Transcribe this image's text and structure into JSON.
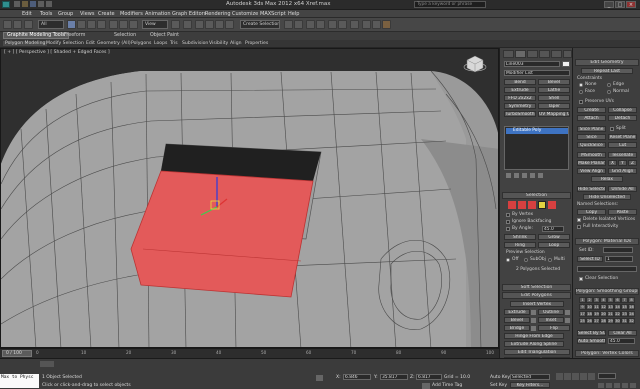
{
  "window": {
    "title": "Autodesk 3ds Max 2012 x64        Xref.max",
    "search_placeholder": "Type a keyword or phrase",
    "minimize": "_",
    "maximize": "□",
    "close": "×"
  },
  "menu": [
    "Edit",
    "Tools",
    "Group",
    "Views",
    "Create",
    "Modifiers",
    "Animation",
    "Graph Editors",
    "Rendering",
    "Customize",
    "MAXScript",
    "Help"
  ],
  "toolbar": {
    "selection_filter": "All",
    "view_dropdown": "View",
    "named_sets": "Create Selection Se"
  },
  "ribbon": {
    "tabs": [
      "Graphite Modeling Tools",
      "Freeform",
      "Selection",
      "Object Paint"
    ],
    "active_tab": "Graphite Modeling Tools",
    "row": [
      "Polygon Modeling",
      "Modify Selection",
      "Edit",
      "Geometry (All)",
      "Polygons",
      "Loops",
      "Tris",
      "Subdivision",
      "Visibility",
      "Align",
      "Properties"
    ]
  },
  "viewport": {
    "label": "[ + ] [ Perspective ] [ Shaded + Edged Faces ]"
  },
  "command_panel": {
    "object_name": "Line003",
    "modifier_list": "Modifier List",
    "quick_buttons": [
      [
        "Bend",
        "Bevel"
      ],
      [
        "Extrude",
        "Lathe"
      ],
      [
        "FFD 2x2x2",
        "Shell"
      ],
      [
        "Symmetry",
        "Taper"
      ],
      [
        "TurboSmooth",
        "UV Mapping Cle"
      ]
    ],
    "stack_item": "Editable Poly",
    "selection_title": "Selection",
    "by_vertex": "By Vertex",
    "ignore_backfacing": "Ignore Backfacing",
    "by_angle": "By Angle:",
    "angle_value": "45.0",
    "shrink": "Shrink",
    "grow": "Grow",
    "ring": "Ring",
    "loop": "Loop",
    "preview_selection": "Preview Selection",
    "preview_off": "Off",
    "preview_subobj": "SubObj",
    "preview_multi": "Multi",
    "selected_status": "2 Polygons Selected",
    "soft_selection": "Soft Selection",
    "edit_polygons": "Edit Polygons",
    "insert_vertex": "Insert Vertex",
    "edit_buttons": [
      [
        "Extrude",
        "Outline"
      ],
      [
        "Bevel",
        "Inset"
      ],
      [
        "Bridge",
        "Flip"
      ]
    ],
    "hinge": "Hinge From Edge",
    "extrude_spline": "Extrude Along Spline",
    "edit_triangulation": "Edit Triangulation",
    "retriangulate": "Retriangulate",
    "turn": "Turn"
  },
  "right_panel": {
    "edit_geometry": "Edit Geometry",
    "repeat_last": "Repeat Last",
    "constraints": "Constraints",
    "c_none": "None",
    "c_edge": "Edge",
    "c_face": "Face",
    "c_normal": "Normal",
    "preserve_uvs": "Preserve UVs",
    "create": "Create",
    "collapse": "Collapse",
    "attach": "Attach",
    "detach": "Detach",
    "slice_plane": "Slice Plane",
    "split": "Split",
    "slice": "Slice",
    "reset_plane": "Reset Plane",
    "quickslice": "QuickSlice",
    "cut": "Cut",
    "msmooth": "MSmooth",
    "tessellate": "Tessellate",
    "make_planar": "Make Planar",
    "x": "X",
    "y": "Y",
    "z": "Z",
    "view_align": "View Align",
    "grid_align": "Grid Align",
    "relax": "Relax",
    "hide_selected": "Hide Selected",
    "unhide_all": "Unhide All",
    "hide_unselected": "Hide Unselected",
    "named_selections": "Named Selections:",
    "copy": "Copy",
    "paste": "Paste",
    "delete_isolated": "Delete Isolated Vertices",
    "full_interactivity": "Full Interactivity",
    "material_ids": "Polygon: Material IDs",
    "set_id": "Set ID:",
    "select_id": "Select ID",
    "id_value": "1",
    "clear_selection": "Clear Selection",
    "smoothing_groups": "Polygon: Smoothing Groups",
    "groups": [
      "1",
      "2",
      "3",
      "4",
      "5",
      "6",
      "7",
      "8",
      "9",
      "10",
      "11",
      "12",
      "13",
      "14",
      "15",
      "16",
      "17",
      "18",
      "19",
      "20",
      "21",
      "22",
      "23",
      "24",
      "25",
      "26",
      "27",
      "28",
      "29",
      "30",
      "31",
      "32"
    ],
    "select_by_sg": "Select By SG",
    "clear_all": "Clear All",
    "auto_smooth": "Auto Smooth",
    "auto_value": "45.0",
    "vertex_colors": "Polygon: Vertex Colors",
    "color": "Color:"
  },
  "timeline": {
    "frame": "0 / 100",
    "ticks": [
      "0",
      "10",
      "20",
      "30",
      "40",
      "50",
      "60",
      "70",
      "80",
      "90",
      "100"
    ]
  },
  "status": {
    "maxscript_line1": "Max to Physc",
    "maxscript_line2": "",
    "objects_selected": "1 Object Selected",
    "prompt": "Click or click-and-drag to select objects",
    "x_label": "X:",
    "x_value": "6.846",
    "y_label": "Y:",
    "y_value": "35.817",
    "z_label": "Z:",
    "z_value": "6.817",
    "grid": "Grid = 10.0",
    "auto_key": "Auto Key",
    "selected": "Selected",
    "set_key": "Set Key",
    "key_filters": "Key Filters...",
    "add_time_tag": "Add Time Tag"
  },
  "colors": {
    "accent": "#3e73c2",
    "selection": "#e35a5a",
    "background": "#3a3a3a"
  }
}
